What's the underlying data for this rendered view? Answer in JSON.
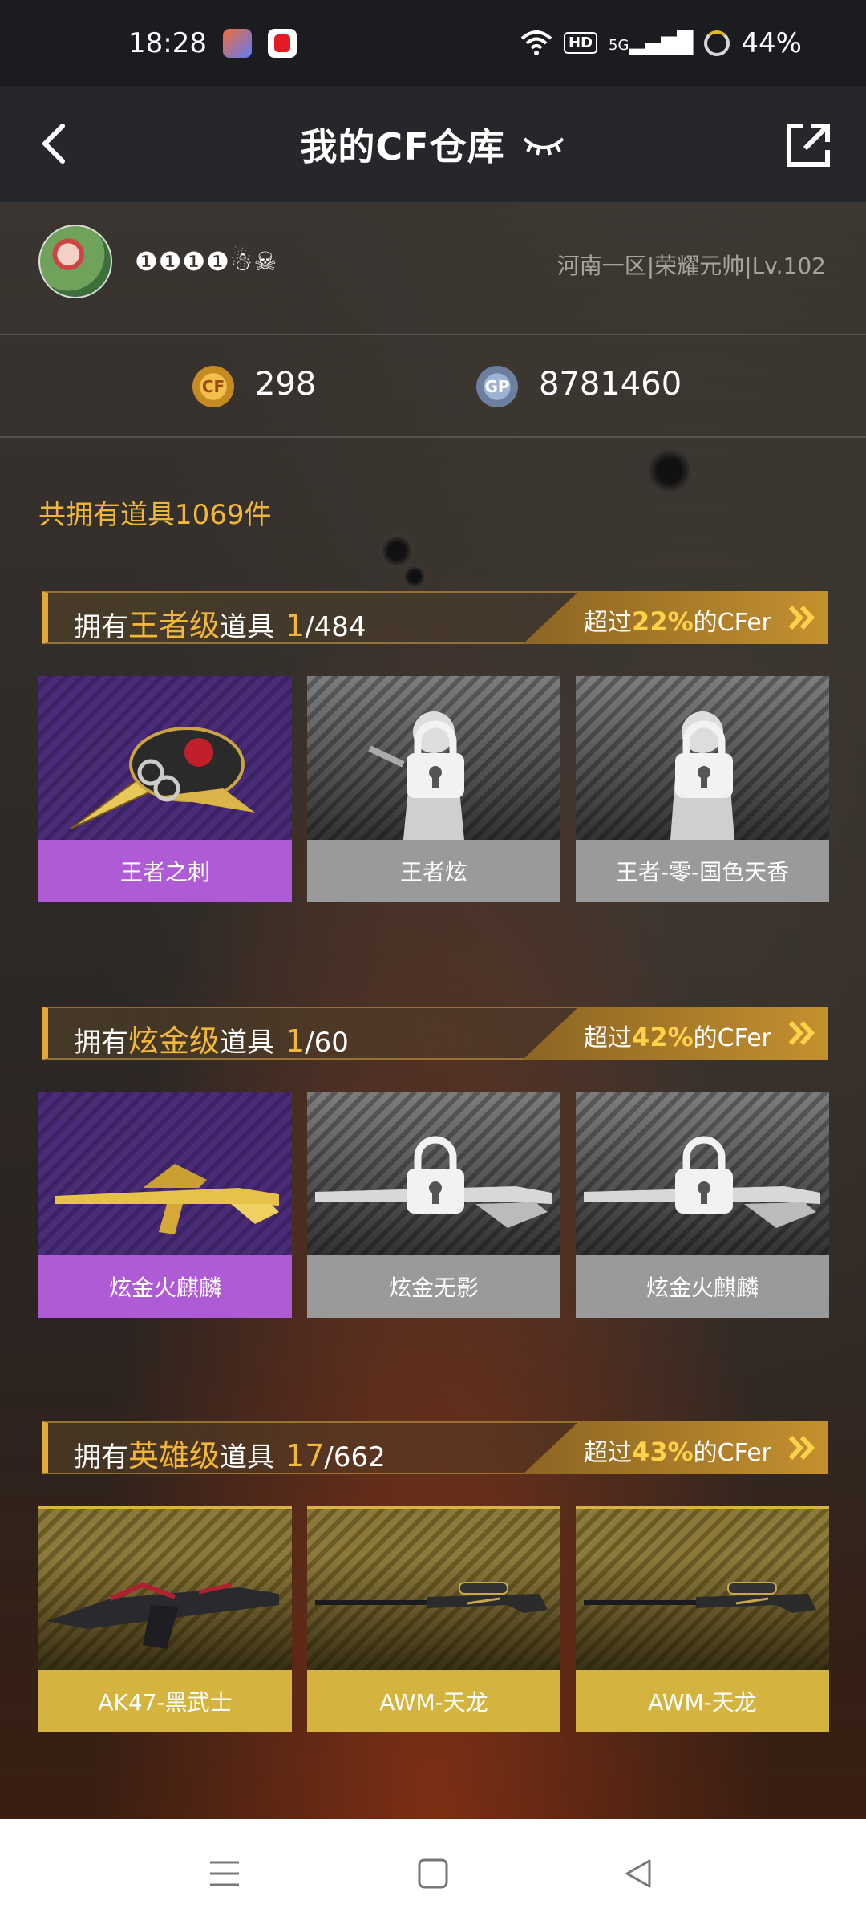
{
  "status_bar": {
    "time": "18:28",
    "hd": "HD",
    "net": "5G",
    "battery": "44%"
  },
  "header": {
    "title": "我的CF仓库"
  },
  "profile": {
    "username": "❶❶❶❶☃☠",
    "server_info": "河南一区|荣耀元帅|Lv.102"
  },
  "currency": {
    "cf_icon": "CF",
    "cf_value": "298",
    "gp_icon": "GP",
    "gp_value": "8781460"
  },
  "total_items": "共拥有道具1069件",
  "sections": [
    {
      "prefix": "拥有",
      "grade": "王者级",
      "suffix": "道具",
      "owned": "1",
      "total": "/484",
      "exceed_prefix": "超过",
      "exceed_pct": "22%",
      "exceed_suffix": "的CFer",
      "items": [
        {
          "label": "王者之刺",
          "owned": true
        },
        {
          "label": "王者炫",
          "owned": false
        },
        {
          "label": "王者-零-国色天香",
          "owned": false
        }
      ]
    },
    {
      "prefix": "拥有",
      "grade": "炫金级",
      "suffix": "道具",
      "owned": "1",
      "total": "/60",
      "exceed_prefix": "超过",
      "exceed_pct": "42%",
      "exceed_suffix": "的CFer",
      "items": [
        {
          "label": "炫金火麒麟",
          "owned": true
        },
        {
          "label": "炫金无影",
          "owned": false
        },
        {
          "label": "炫金火麒麟",
          "owned": false
        }
      ]
    },
    {
      "prefix": "拥有",
      "grade": "英雄级",
      "suffix": "道具",
      "owned": "17",
      "total": "/662",
      "exceed_prefix": "超过",
      "exceed_pct": "43%",
      "exceed_suffix": "的CFer",
      "items": [
        {
          "label": "AK47-黑武士",
          "owned": true
        },
        {
          "label": "AWM-天龙",
          "owned": true
        },
        {
          "label": "AWM-天龙",
          "owned": true
        }
      ]
    }
  ],
  "colors": {
    "accent_gold": "#f2b73a",
    "owned_purple": "#b05bd6",
    "locked_gray": "#9a9a9a",
    "hero_gold": "#d4b43e"
  },
  "icons": {
    "back": "back-arrow-icon",
    "share": "share-external-icon",
    "visibility": "eye-closed-icon",
    "lock": "lock-icon"
  }
}
